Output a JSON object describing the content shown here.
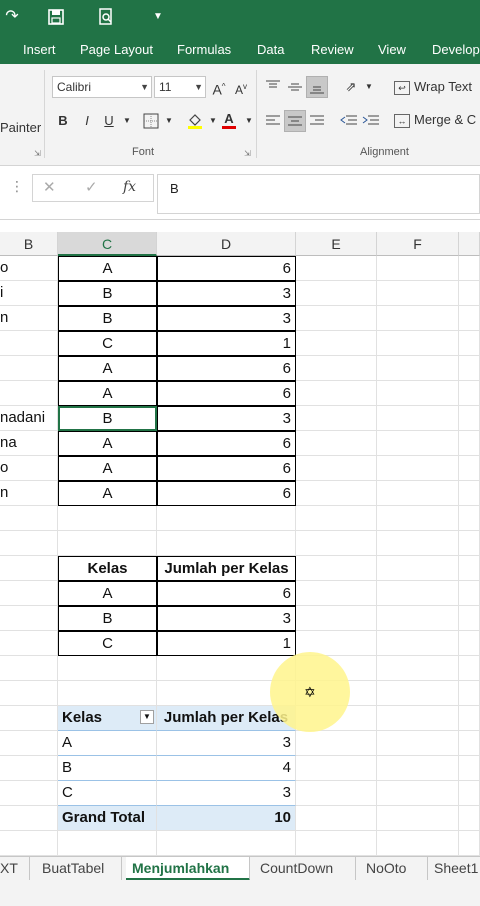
{
  "qat": {
    "icons": [
      "redo-icon",
      "save-icon",
      "print-preview-icon",
      "customize-icon"
    ]
  },
  "tabs": [
    "Insert",
    "Page Layout",
    "Formulas",
    "Data",
    "Review",
    "View",
    "Develop"
  ],
  "ribbon": {
    "painter_label": "Painter",
    "font_name": "Calibri",
    "font_size": "11",
    "bold": "B",
    "italic": "I",
    "underline": "U",
    "grow_font": "A",
    "shrink_font": "A",
    "font_color": "A",
    "font_group": "Font",
    "wrap_text": "Wrap Text",
    "merge_center": "Merge & C",
    "alignment_group": "Alignment"
  },
  "formula_bar": {
    "value": "B",
    "fx": "fx"
  },
  "columns": [
    "B",
    "C",
    "D",
    "E",
    "F"
  ],
  "data_rows": [
    {
      "b": "o",
      "c": "A",
      "d": "6"
    },
    {
      "b": "i",
      "c": "B",
      "d": "3"
    },
    {
      "b": "n",
      "c": "B",
      "d": "3"
    },
    {
      "b": "",
      "c": "C",
      "d": "1"
    },
    {
      "b": "",
      "c": "A",
      "d": "6"
    },
    {
      "b": "",
      "c": "A",
      "d": "6"
    },
    {
      "b": "nadani",
      "c": "B",
      "d": "3"
    },
    {
      "b": "na",
      "c": "A",
      "d": "6"
    },
    {
      "b": "o",
      "c": "A",
      "d": "6"
    },
    {
      "b": "n",
      "c": "A",
      "d": "6"
    }
  ],
  "summary": {
    "header_kelas": "Kelas",
    "header_jumlah": "Jumlah per Kelas",
    "rows": [
      {
        "kelas": "A",
        "jumlah": "6"
      },
      {
        "kelas": "B",
        "jumlah": "3"
      },
      {
        "kelas": "C",
        "jumlah": "1"
      }
    ]
  },
  "pivot": {
    "header_kelas": "Kelas",
    "header_jumlah": "Jumlah per Kelas",
    "rows": [
      {
        "kelas": "A",
        "jumlah": "3"
      },
      {
        "kelas": "B",
        "jumlah": "4"
      },
      {
        "kelas": "C",
        "jumlah": "3"
      }
    ],
    "grand_total_label": "Grand Total",
    "grand_total_value": "10"
  },
  "sheet_tabs": [
    "XT",
    "BuatTabel",
    "Menjumlahkan",
    "CountDown",
    "NoOto",
    "Sheet1"
  ],
  "active_sheet": "Menjumlahkan",
  "colors": {
    "accent": "#217346",
    "pivot_header": "#ddebf7",
    "highlight": "#fff58c"
  }
}
